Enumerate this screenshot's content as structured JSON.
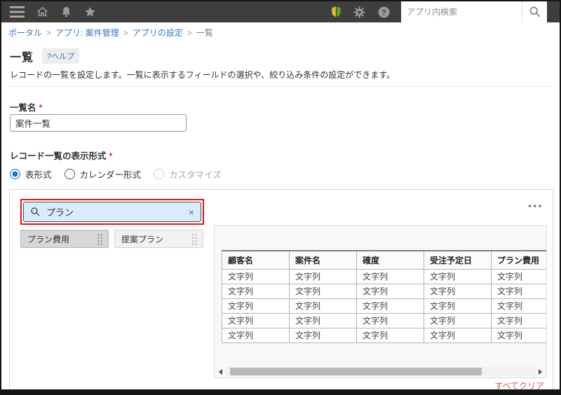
{
  "colors": {
    "topbar_bg": "#3e3e3e",
    "link_blue": "#3b78be",
    "annotation_red": "#e01414",
    "radio_accent": "#1f76c6",
    "search_highlight_bg": "#d9ecfb",
    "clear_link_red": "#d9605c",
    "required_red": "#e53935"
  },
  "topbar": {
    "icons": [
      "menu-icon",
      "home-icon",
      "notification-bell-icon",
      "star-icon",
      "beginner-mark-icon",
      "gear-icon",
      "help-icon",
      "search-icon"
    ],
    "search_placeholder": "アプリ内検索"
  },
  "breadcrumb": {
    "separator": ">",
    "items": [
      {
        "label": "ポータル"
      },
      {
        "label": "アプリ: 案件管理"
      },
      {
        "label": "アプリの設定"
      },
      {
        "label": "一覧"
      }
    ]
  },
  "page": {
    "title": "一覧",
    "help_label": "?ヘルプ",
    "description": "レコードの一覧を設定します。一覧に表示するフィールドの選択や、絞り込み条件の設定ができます。"
  },
  "form": {
    "list_name": {
      "label": "一覧名",
      "required_mark": "*",
      "value": "案件一覧"
    },
    "display_format": {
      "label": "レコード一覧の表示形式",
      "required_mark": "*",
      "options": [
        {
          "label": "表形式",
          "selected": true,
          "disabled": false
        },
        {
          "label": "カレンダー形式",
          "selected": false,
          "disabled": false
        },
        {
          "label": "カスタマイズ",
          "selected": false,
          "disabled": true
        }
      ]
    }
  },
  "field_picker": {
    "search_value": "プラン",
    "clear_label": "×",
    "menu_label": "•••",
    "chips": [
      {
        "label": "プラン費用",
        "state": "used"
      },
      {
        "label": "提案プラン",
        "state": "available"
      }
    ],
    "clear_all_label": "すべてクリア"
  },
  "preview_table": {
    "columns": [
      "顧客名",
      "案件名",
      "確度",
      "受注予定日",
      "プラン費用"
    ],
    "rows": [
      [
        "文字列",
        "文字列",
        "文字列",
        "文字列",
        "文字列"
      ],
      [
        "文字列",
        "文字列",
        "文字列",
        "文字列",
        "文字列"
      ],
      [
        "文字列",
        "文字列",
        "文字列",
        "文字列",
        "文字列"
      ],
      [
        "文字列",
        "文字列",
        "文字列",
        "文字列",
        "文字列"
      ],
      [
        "文字列",
        "文字列",
        "文字列",
        "文字列",
        "文字列"
      ]
    ]
  }
}
